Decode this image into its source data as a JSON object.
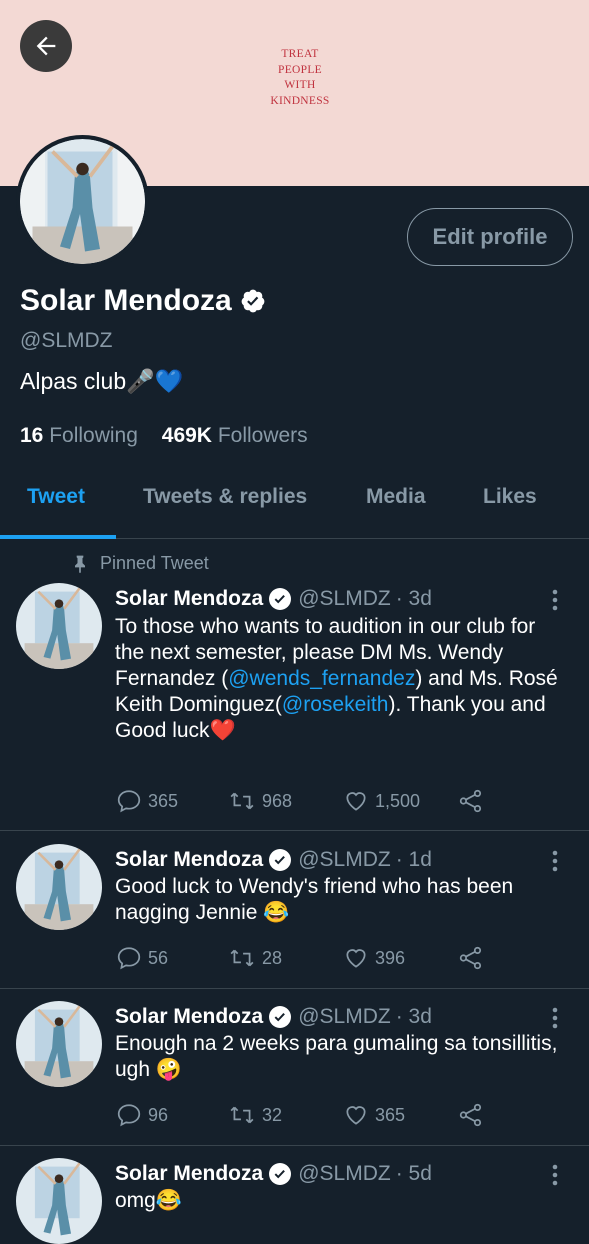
{
  "banner": {
    "text_lines": [
      "TREAT",
      "PEOPLE",
      "WITH",
      "KINDNESS"
    ]
  },
  "header": {
    "back_icon": "arrow-left-icon",
    "edit_label": "Edit profile"
  },
  "profile": {
    "name": "Solar Mendoza",
    "handle": "@SLMDZ",
    "bio": "Alpas club",
    "bio_emoji": "🎤💙",
    "following_count": "16",
    "following_label": "Following",
    "followers_count": "469K",
    "followers_label": "Followers"
  },
  "tabs": [
    "Tweet",
    "Tweets & replies",
    "Media",
    "Likes"
  ],
  "pinned_label": "Pinned Tweet",
  "tweets": [
    {
      "name": "Solar Mendoza",
      "handle": "@SLMDZ",
      "time": "· 3d",
      "text_parts": [
        "To those who wants to audition in our club for the next semester, please DM Ms. Wendy Fernandez (",
        "@wends_fernandez",
        ") and Ms. Rosé Keith Dominguez(",
        "@rosekeith",
        "). Thank you and Good luck",
        "❤️"
      ],
      "replies": "365",
      "retweets": "968",
      "likes": "1,500"
    },
    {
      "name": "Solar Mendoza",
      "handle": "@SLMDZ",
      "time": "· 1d",
      "text": "Good luck to Wendy's friend who has been nagging Jennie",
      "emoji": "😂",
      "replies": "56",
      "retweets": "28",
      "likes": "396"
    },
    {
      "name": "Solar Mendoza",
      "handle": "@SLMDZ",
      "time": "· 3d",
      "text": "Enough na 2 weeks para gumaling sa tonsillitis, ugh",
      "emoji": "🤪",
      "replies": "96",
      "retweets": "32",
      "likes": "365"
    },
    {
      "name": "Solar Mendoza",
      "handle": "@SLMDZ",
      "time": "· 5d",
      "text": "omg",
      "emoji": "😂"
    }
  ],
  "colors": {
    "background": "#15202b",
    "accent": "#1da1f2",
    "muted": "#8899a6",
    "banner": "#f3d9d4",
    "banner_text": "#c0333f"
  }
}
